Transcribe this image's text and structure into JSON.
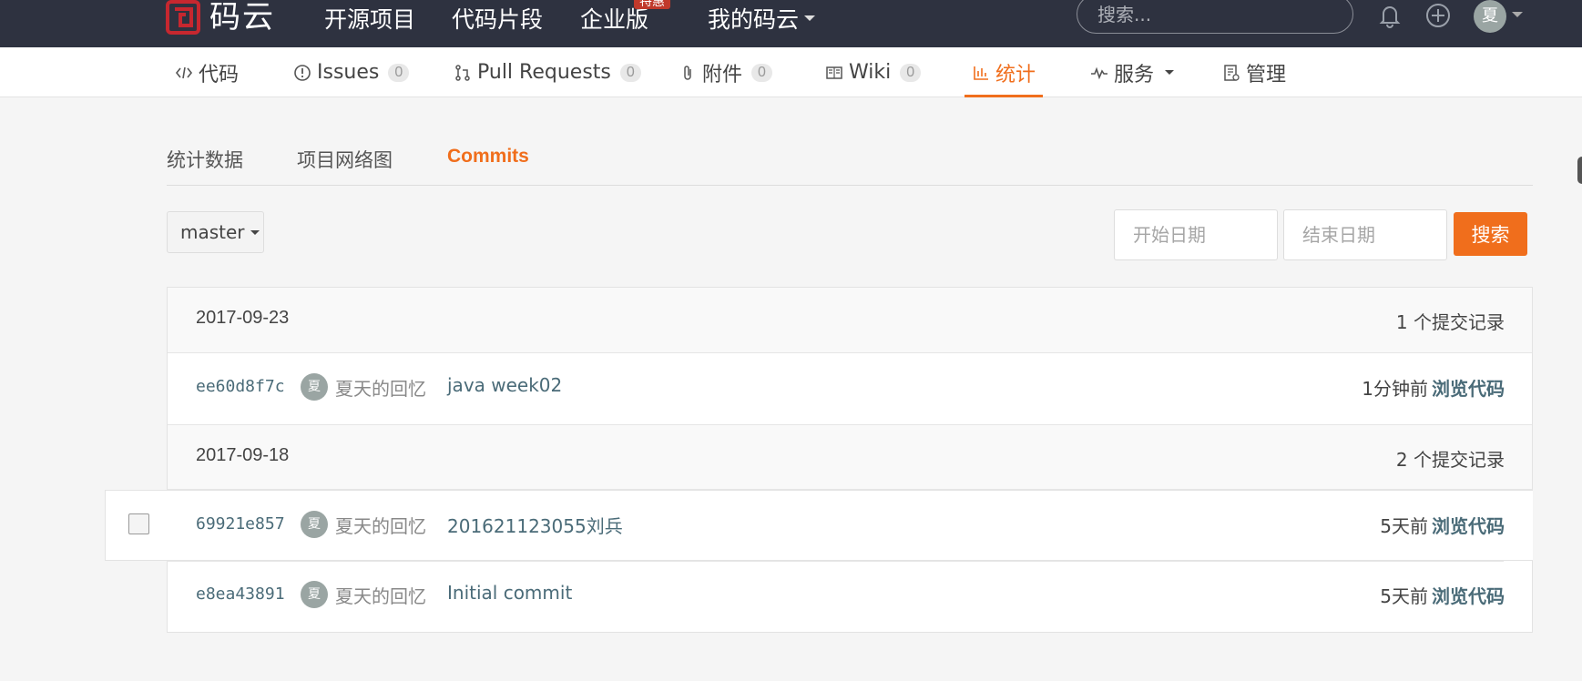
{
  "brand": {
    "logo_text": "码云",
    "accent": "#f06e1c",
    "topbar_bg": "#2e3240"
  },
  "topnav": {
    "items": [
      "开源项目",
      "代码片段",
      "企业版",
      "我的码云"
    ],
    "badge": "特惠",
    "search_placeholder": "搜索...",
    "icons": [
      "bell-icon",
      "plus-circle-icon"
    ],
    "avatar_char": "夏"
  },
  "repo_tabs": [
    {
      "label": "代码",
      "icon": "code-icon"
    },
    {
      "label": "Issues",
      "count": "0",
      "icon": "info-circle-icon"
    },
    {
      "label": "Pull Requests",
      "count": "0",
      "icon": "pull-request-icon"
    },
    {
      "label": "附件",
      "count": "0",
      "icon": "paperclip-icon"
    },
    {
      "label": "Wiki",
      "count": "0",
      "icon": "book-icon"
    },
    {
      "label": "统计",
      "icon": "bar-chart-icon",
      "active": true
    },
    {
      "label": "服务",
      "icon": "pulse-icon"
    },
    {
      "label": "管理",
      "icon": "settings-doc-icon"
    }
  ],
  "sub_tabs": [
    "统计数据",
    "项目网络图",
    "Commits"
  ],
  "filters": {
    "branch": "master",
    "start_placeholder": "开始日期",
    "end_placeholder": "结束日期",
    "search_label": "搜索"
  },
  "groups": [
    {
      "date": "2017-09-23",
      "count_label": "1 个提交记录",
      "commits": [
        {
          "sha": "ee60d8f7c",
          "avatar": "夏",
          "author": "夏天的回忆",
          "message": "java week02",
          "time": "1分钟前",
          "browse": "浏览代码"
        }
      ]
    },
    {
      "date": "2017-09-18",
      "count_label": "2 个提交记录",
      "commits": [
        {
          "sha": "69921e857",
          "avatar": "夏",
          "author": "夏天的回忆",
          "message": "201621123055刘兵",
          "time": "5天前",
          "browse": "浏览代码"
        },
        {
          "sha": "e8ea43891",
          "avatar": "夏",
          "author": "夏天的回忆",
          "message": "Initial commit",
          "time": "5天前",
          "browse": "浏览代码"
        }
      ]
    }
  ]
}
